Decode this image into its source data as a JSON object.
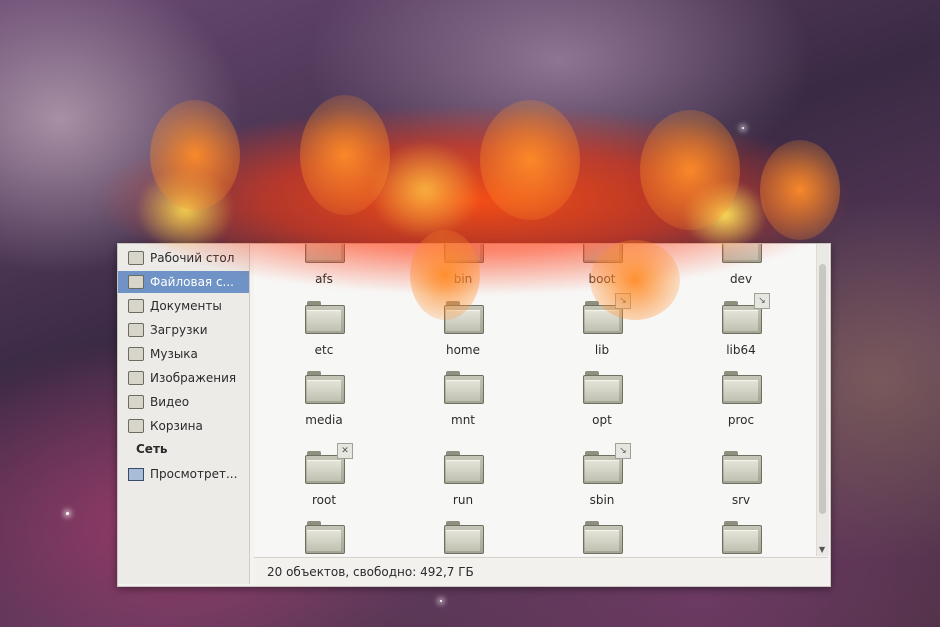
{
  "sidebar": {
    "places": [
      {
        "label": "Рабочий стол",
        "icon": "desktop-icon"
      },
      {
        "label": "Файловая с...",
        "icon": "filesystem-icon",
        "selected": true
      },
      {
        "label": "Документы",
        "icon": "documents-folder-icon"
      },
      {
        "label": "Загрузки",
        "icon": "downloads-folder-icon"
      },
      {
        "label": "Музыка",
        "icon": "music-folder-icon"
      },
      {
        "label": "Изображения",
        "icon": "pictures-folder-icon"
      },
      {
        "label": "Видео",
        "icon": "videos-folder-icon"
      },
      {
        "label": "Корзина",
        "icon": "trash-icon"
      }
    ],
    "network_header": "Сеть",
    "network_items": [
      {
        "label": "Просмотрет...",
        "icon": "network-icon"
      }
    ]
  },
  "folders": [
    {
      "name": "afs"
    },
    {
      "name": "bin"
    },
    {
      "name": "boot"
    },
    {
      "name": "dev"
    },
    {
      "name": "etc"
    },
    {
      "name": "home"
    },
    {
      "name": "lib",
      "badge": "symlink"
    },
    {
      "name": "lib64",
      "badge": "symlink"
    },
    {
      "name": "media"
    },
    {
      "name": "mnt"
    },
    {
      "name": "opt"
    },
    {
      "name": "proc"
    },
    {
      "name": "root",
      "badge": "locked"
    },
    {
      "name": "run"
    },
    {
      "name": "sbin",
      "badge": "symlink"
    },
    {
      "name": "srv"
    },
    {
      "name": ""
    },
    {
      "name": ""
    },
    {
      "name": ""
    },
    {
      "name": ""
    }
  ],
  "status": {
    "text": "20 объектов, свободно: 492,7 ГБ"
  },
  "colors": {
    "selection": "#6f93c6",
    "fire": "#ff5a1e"
  }
}
